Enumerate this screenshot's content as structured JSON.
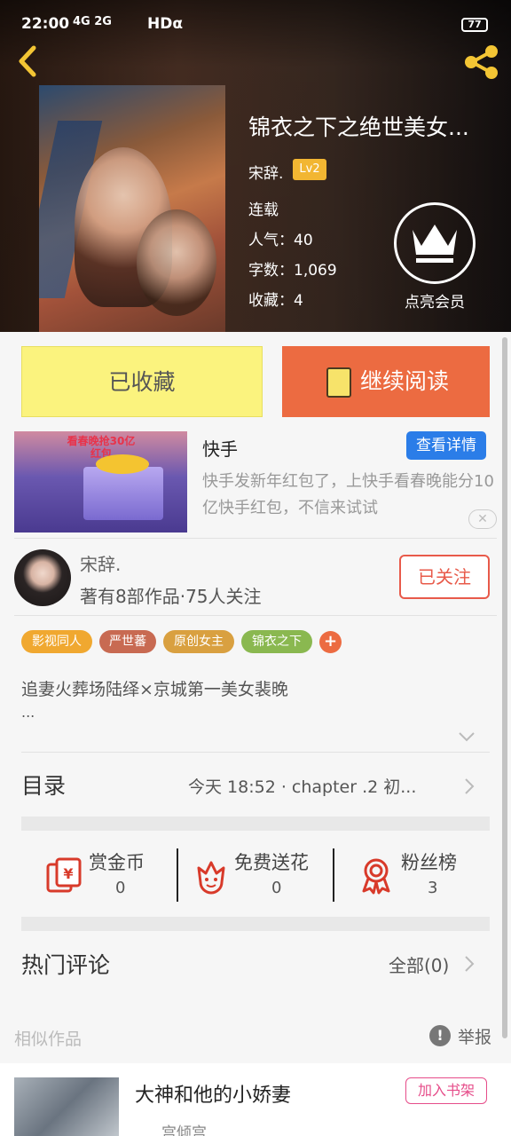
{
  "status_bar": {
    "time": "22:00",
    "network": "4G 2G",
    "hd": "HDα",
    "battery": "77"
  },
  "book": {
    "title": "锦衣之下之绝世美女...",
    "author": "宋辞.",
    "level": "Lv2",
    "status": "连载",
    "popularity": "人气：40",
    "word_count": "字数：1,069",
    "favorites": "收藏：4",
    "vip_label": "点亮会员"
  },
  "actions": {
    "favorited": "已收藏",
    "continue_reading": "继续阅读"
  },
  "ad": {
    "headline": "看春晚抢30亿红包",
    "title": "快手",
    "detail_button": "查看详情",
    "description": "快手发新年红包了，上快手看春晚能分10亿快手红包，不信来试试",
    "close": "✕"
  },
  "author_card": {
    "name": "宋辞.",
    "stats": "著有8部作品·75人关注",
    "follow_button": "已关注"
  },
  "tags": [
    {
      "label": "影视同人",
      "color": "#f0a830"
    },
    {
      "label": "严世蕃",
      "color": "#c86a52"
    },
    {
      "label": "原创女主",
      "color": "#d9a040"
    },
    {
      "label": "锦衣之下",
      "color": "#8ab850"
    }
  ],
  "tag_add": "+",
  "synopsis": {
    "line1": "追妻火葬场陆绎×京城第一美女裴晚",
    "line2": "..."
  },
  "toc": {
    "label": "目录",
    "latest": "今天 18:52 · chapter .2 初..."
  },
  "stats": [
    {
      "label": "赏金币",
      "value": "0",
      "icon": "reward-coin-icon"
    },
    {
      "label": "免费送花",
      "value": "0",
      "icon": "flower-icon"
    },
    {
      "label": "粉丝榜",
      "value": "3",
      "icon": "fan-ranking-icon"
    }
  ],
  "comments": {
    "label": "热门评论",
    "all": "全部(0)"
  },
  "similar": {
    "label": "相似作品",
    "report": "举报",
    "report_icon": "!",
    "items": [
      {
        "title": "大神和他的小娇妻",
        "author": "宫倾宫",
        "add_button": "加入书架"
      }
    ]
  },
  "colors": {
    "accent_orange": "#ec6b41",
    "fav_yellow": "#fbf37e",
    "ad_blue": "#2b7de8",
    "follow_red": "#e85a4a"
  }
}
